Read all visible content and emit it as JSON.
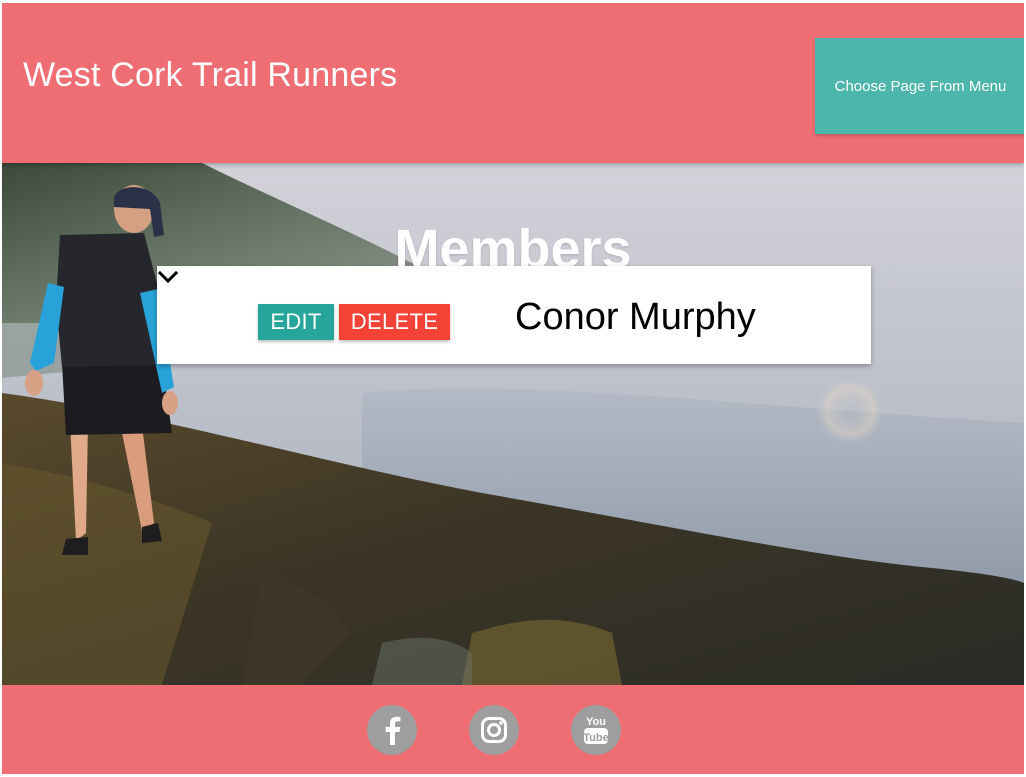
{
  "header": {
    "brand": "West Cork Trail Runners",
    "menu_label": "Choose Page From Menu"
  },
  "page": {
    "title": "Members"
  },
  "member": {
    "name": "Conor Murphy",
    "edit_label": "EDIT",
    "delete_label": "DELETE",
    "expand_icon": "chevron-down-icon"
  },
  "footer": {
    "social": [
      {
        "icon": "facebook-icon"
      },
      {
        "icon": "instagram-icon"
      },
      {
        "icon": "youtube-icon"
      }
    ]
  },
  "colors": {
    "header_bg": "#ef6e73",
    "menu_button_bg": "#4db6ac",
    "edit_button_bg": "#26a69a",
    "delete_button_bg": "#f44336",
    "social_icon_bg": "#9e9e9e"
  }
}
